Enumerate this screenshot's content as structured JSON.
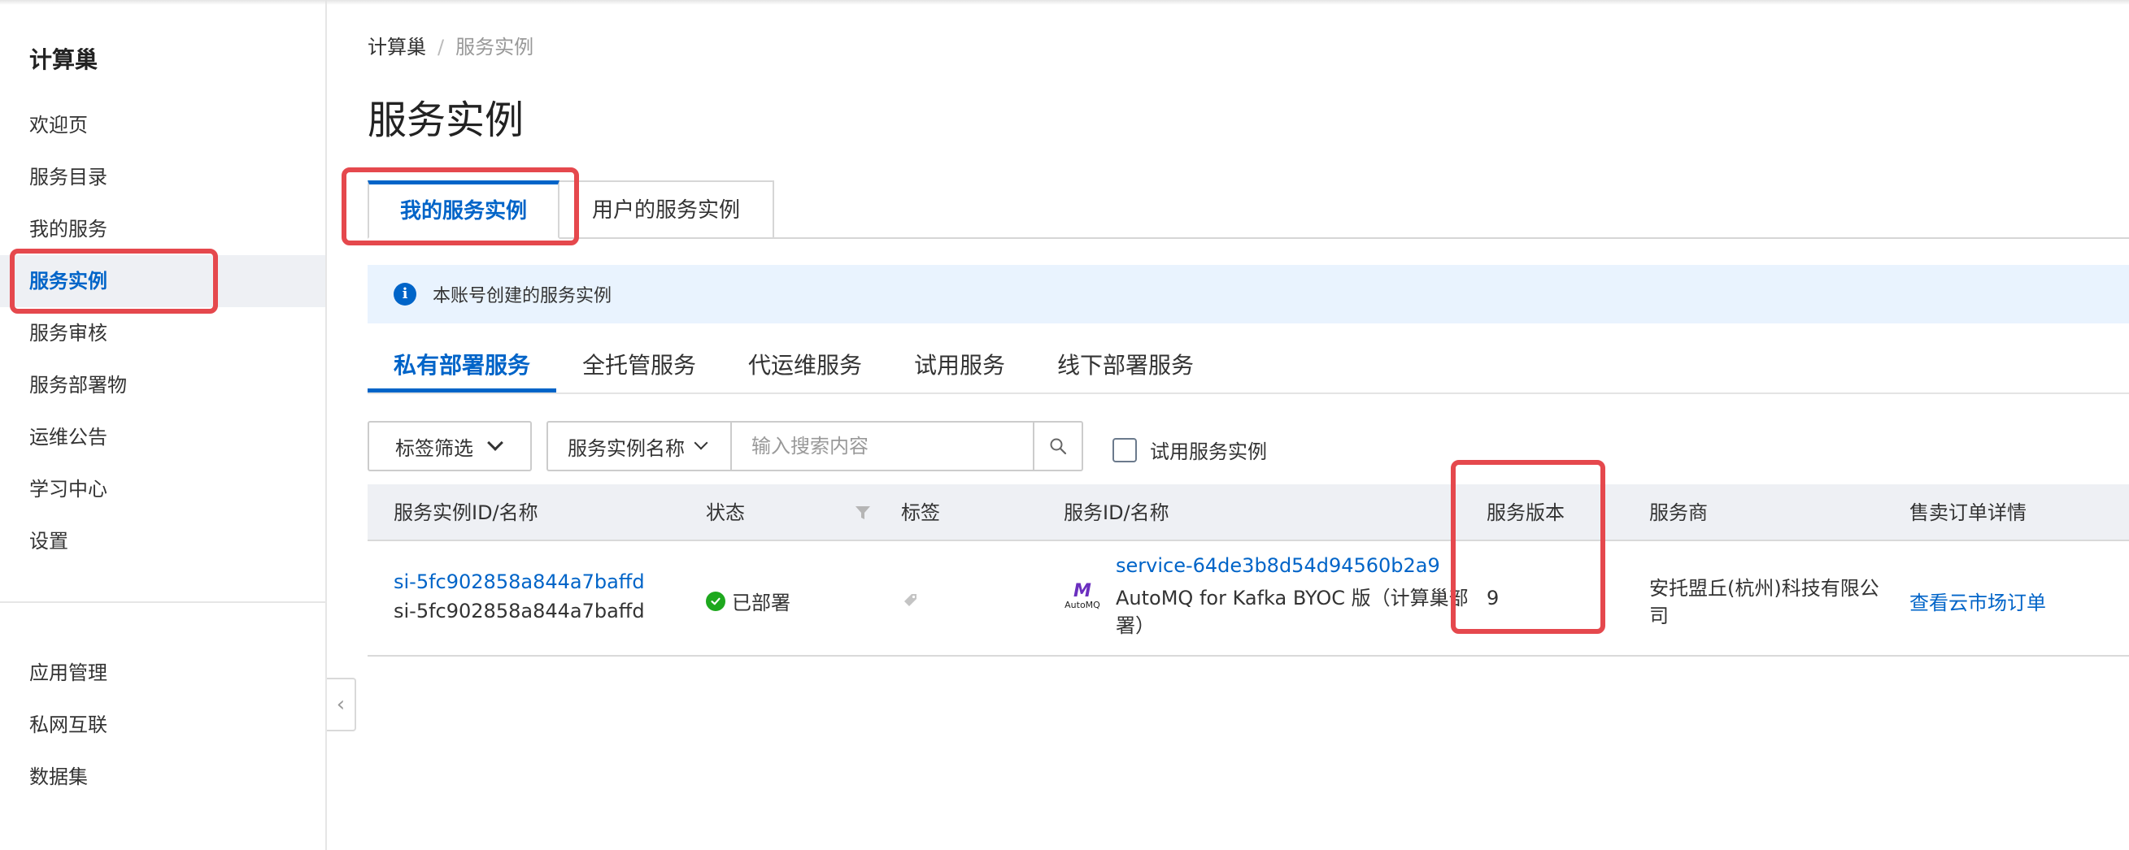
{
  "sidebar": {
    "title": "计算巢",
    "items": [
      {
        "label": "欢迎页"
      },
      {
        "label": "服务目录"
      },
      {
        "label": "我的服务"
      },
      {
        "label": "服务实例"
      },
      {
        "label": "服务审核"
      },
      {
        "label": "服务部署物"
      },
      {
        "label": "运维公告"
      },
      {
        "label": "学习中心"
      },
      {
        "label": "设置"
      }
    ],
    "bottom_items": [
      {
        "label": "应用管理"
      },
      {
        "label": "私网互联"
      },
      {
        "label": "数据集"
      }
    ],
    "collapse_glyph": "‹"
  },
  "breadcrumb": {
    "root": "计算巢",
    "separator": "/",
    "current": "服务实例"
  },
  "page_title": "服务实例",
  "tabs": [
    {
      "label": "我的服务实例",
      "active": true
    },
    {
      "label": "用户的服务实例",
      "active": false
    }
  ],
  "info_bar": {
    "icon_glyph": "i",
    "text": "本账号创建的服务实例"
  },
  "subtabs": [
    {
      "label": "私有部署服务",
      "active": true
    },
    {
      "label": "全托管服务",
      "active": false
    },
    {
      "label": "代运维服务",
      "active": false
    },
    {
      "label": "试用服务",
      "active": false
    },
    {
      "label": "线下部署服务",
      "active": false
    }
  ],
  "filters": {
    "tag_filter_label": "标签筛选",
    "search_field_label": "服务实例名称",
    "search_placeholder": "输入搜索内容",
    "trial_checkbox_label": "试用服务实例"
  },
  "table": {
    "columns": [
      {
        "label": "服务实例ID/名称"
      },
      {
        "label": "状态"
      },
      {
        "label": "标签"
      },
      {
        "label": "服务ID/名称"
      },
      {
        "label": "服务版本"
      },
      {
        "label": "服务商"
      },
      {
        "label": "售卖订单详情"
      }
    ],
    "rows": [
      {
        "instance_id": "si-5fc902858a844a7baffd",
        "instance_name": "si-5fc902858a844a7baffd",
        "status": "已部署",
        "service_id": "service-64de3b8d54d94560b2a9",
        "service_name_line1": "AutoMQ for Kafka BYOC 版（计算巢部",
        "service_name_line2": "署）",
        "logo_mark": "M",
        "logo_text": "AutoMQ",
        "version": "9",
        "vendor_line1": "安托盟丘(杭州)科技有限公",
        "vendor_line2": "司",
        "order_link": "查看云市场订单"
      }
    ]
  },
  "colors": {
    "accent": "#0064c8",
    "annotation": "#e5484d",
    "success": "#1ea81e",
    "info_bg": "#e9f3fe"
  }
}
